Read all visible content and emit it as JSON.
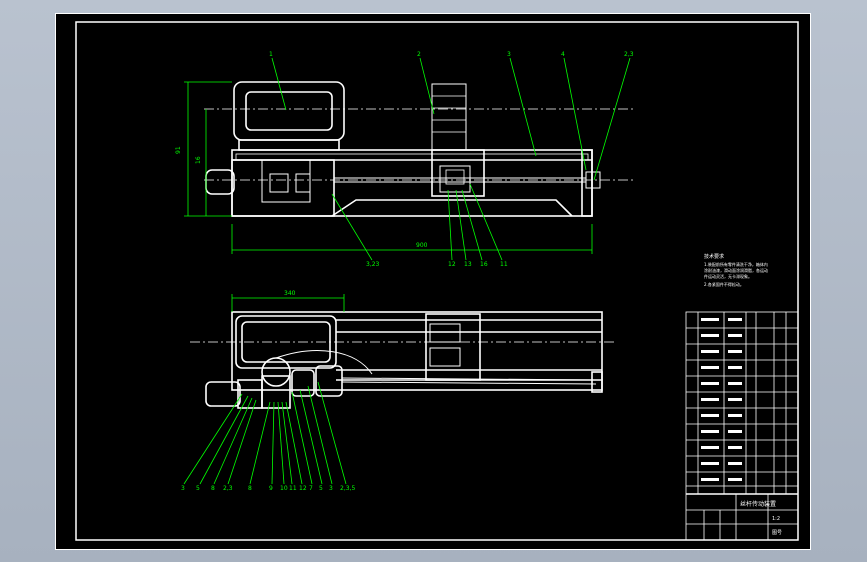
{
  "drawing": {
    "balloons_top": [
      "1",
      "2",
      "3",
      "4",
      "2,3"
    ],
    "balloons_top_bottom": [
      "3,23",
      "12",
      "13",
      "16",
      "11"
    ],
    "balloons_plan": [
      "3",
      "5",
      "8",
      "2,3",
      "8",
      "9",
      "10",
      "11",
      "12",
      "7",
      "5",
      "3",
      "2,3,5"
    ],
    "dim_overall_length": "900",
    "dim_plan_width": "340",
    "dim_height_left": "91",
    "dim_height_right": "16"
  },
  "notes": {
    "heading": "技术要求",
    "lines": [
      "1.装配前所有零件清洗干净，箱体内",
      "涂耐油漆，滑动面涂润滑脂，各运动",
      "件运动灵活，无卡滞现象。",
      "2.各紧固件不得松动。"
    ]
  },
  "title_block": {
    "title": "丝杆传动装置",
    "drawing_no": "1:2",
    "sheet": "图号"
  },
  "colors": {
    "background": "#000000",
    "lines": "#ffffff",
    "leaders": "#00ff00",
    "outer_frame": "#b9c2cf"
  }
}
